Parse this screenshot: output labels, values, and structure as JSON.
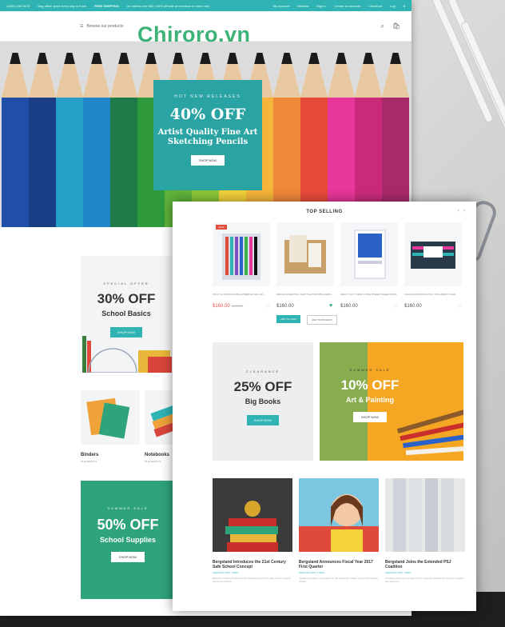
{
  "watermark": "Chiroro.vn",
  "topbar": {
    "phone": "1(800) 234 5678",
    "phone_note": "Bag office open every day at 9 am",
    "shipping": "FREE SHIPPING",
    "shipping_note": "on orders over $50 | 30% off sale at checkout in store only",
    "links": [
      "My Account",
      "Wishlist",
      "Sign in",
      "Create an account",
      "Checkout",
      "Log",
      "$"
    ]
  },
  "header": {
    "browse_label": "Browse our products",
    "icons": [
      "menu-icon",
      "search-icon",
      "cart-icon"
    ]
  },
  "hero": {
    "kicker": "HOT NEW RELEASES",
    "headline": "40% OFF",
    "subline": "Artist Quality Fine Art Sketching Pencils",
    "button": "SHOP NOW"
  },
  "promos_back": [
    {
      "kicker": "SPECIAL OFFER",
      "headline": "30% OFF",
      "subline": "School Basics",
      "button": "SHOP NOW"
    },
    {
      "kicker": "SUMMER SALE",
      "headline": "50% OFF",
      "subline": "School Supplies",
      "button": "SHOP NOW"
    }
  ],
  "categories": [
    {
      "label": "Binders",
      "sub": "40 ELEMENTS"
    },
    {
      "label": "Notebooks",
      "sub": "56 ELEMENTS"
    }
  ],
  "top_selling": {
    "title": "TOP SELLING",
    "products": [
      {
        "name": "PILOT G2 RETRACTABLE PREMIUM GEL INK...",
        "price": "$160.00",
        "old_price": "$180.00",
        "sale": true,
        "wish_active": false
      },
      {
        "name": "DESIGN ESSENTIAL SHUTTLE PORTABLE DESK...",
        "price": "$160.00",
        "old_price": "",
        "sale": false,
        "wish_active": true
      },
      {
        "name": "HEAVY DUTY VIEW 3 RING BINDER SHEER BOOK",
        "price": "$160.00",
        "old_price": "",
        "sale": false,
        "wish_active": false
      },
      {
        "name": "CLEAR EXPANDING POLY DOCUMENT CASE",
        "price": "$160.00",
        "old_price": "",
        "sale": false,
        "wish_active": false
      }
    ],
    "add_to_cart": "ADD TO CART",
    "add_to_wishlist": "ADD TO WISHLIST",
    "sale_badge": "SALE"
  },
  "promos_front": [
    {
      "kicker": "CLEARANCE",
      "headline": "25% OFF",
      "subline": "Big Books",
      "button": "SHOP NOW"
    },
    {
      "kicker": "SUMMER SALE",
      "headline": "10% OFF",
      "subline": "Art & Painting",
      "button": "SHOP NOW"
    }
  ],
  "blog": [
    {
      "title": "Bergsland Introduces the 21st Century Safe School Concept",
      "meta": "September 2017 / News",
      "text": "Effective enrollment ideas for the development of the safe school concept across the district..."
    },
    {
      "title": "Bergsland Announces Fiscal Year 2017 First Quarter",
      "meta": "September 2017 / News",
      "text": "Leading distributor of supplies for the education market reports first quarter results..."
    },
    {
      "title": "Bergsland Joins the Extended PSJ Coalition",
      "meta": "September 2017 / News",
      "text": "Company becomes member of the extended coalition for learning supplies and services..."
    }
  ]
}
